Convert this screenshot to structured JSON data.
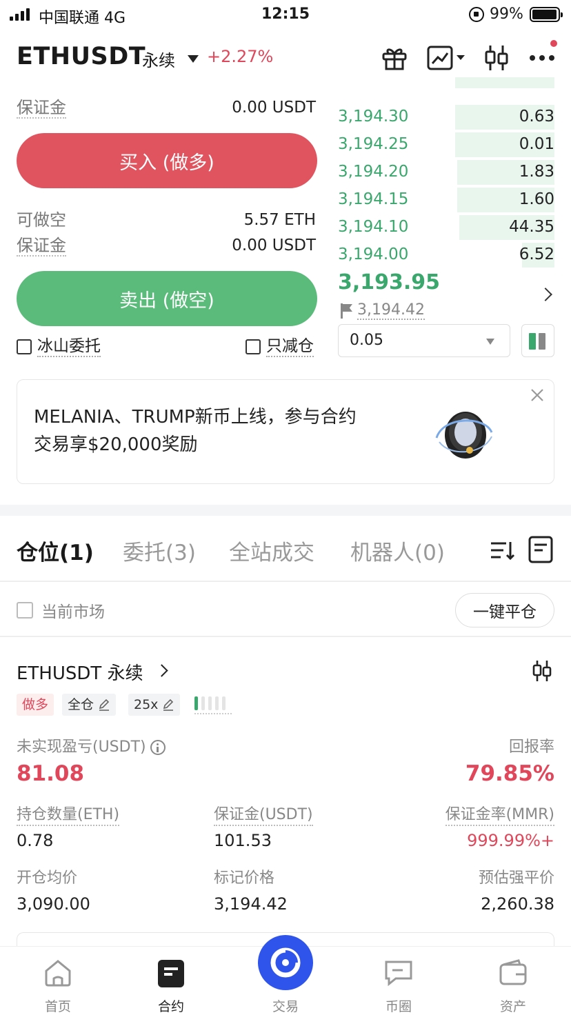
{
  "status_bar": {
    "carrier": "中国联通  4G",
    "time": "12:15",
    "battery": "99%"
  },
  "header": {
    "symbol": "ETHUSDT",
    "contract_type": "永续",
    "change": "+2.27%"
  },
  "trade_panel": {
    "buy_margin_label": "保证金",
    "buy_margin_value": "0.00 USDT",
    "buy_button": "买入 (做多)",
    "short_label": "可做空",
    "short_value": "5.57 ETH",
    "sell_margin_label": "保证金",
    "sell_margin_value": "0.00 USDT",
    "sell_button": "卖出 (做空)",
    "iceberg_label": "冰山委托",
    "reduce_only_label": "只减仓"
  },
  "order_book": {
    "rows": [
      {
        "price": "3,194.30",
        "qty": "0.63",
        "depth": 0.46
      },
      {
        "price": "3,194.25",
        "qty": "0.01",
        "depth": 0.46
      },
      {
        "price": "3,194.20",
        "qty": "1.83",
        "depth": 0.45
      },
      {
        "price": "3,194.15",
        "qty": "1.60",
        "depth": 0.45
      },
      {
        "price": "3,194.10",
        "qty": "44.35",
        "depth": 0.44
      },
      {
        "price": "3,194.00",
        "qty": "6.52",
        "depth": 0.15
      }
    ],
    "last_price": "3,193.95",
    "mark_price": "3,194.42",
    "qty_selector": "0.05"
  },
  "banner": {
    "text_line1": "MELANIA、TRUMP新币上线，参与合约",
    "text_line2": "交易享$20,000奖励"
  },
  "tabs": [
    {
      "label": "仓位(1)",
      "active": true
    },
    {
      "label": "委托(3)",
      "active": false
    },
    {
      "label": "全站成交",
      "active": false
    },
    {
      "label": "机器人(0)",
      "active": false
    }
  ],
  "filter": {
    "current_market": "当前市场",
    "close_all": "一键平仓"
  },
  "position": {
    "title": "ETHUSDT 永续",
    "side_tag": "做多",
    "margin_mode": "全仓",
    "leverage": "25x",
    "risk_level": 1,
    "risk_levels_total": 5,
    "unrealized_pnl_label": "未实现盈亏(USDT)",
    "unrealized_pnl": "81.08",
    "roe_label": "回报率",
    "roe": "79.85%",
    "size_label": "持仓数量(ETH)",
    "size": "0.78",
    "margin_label": "保证金(USDT)",
    "margin": "101.53",
    "mmr_label": "保证金率(MMR)",
    "mmr": "999.99%+",
    "entry_label": "开仓均价",
    "entry": "3,090.00",
    "mark_label": "标记价格",
    "mark": "3,194.42",
    "liq_label": "预估强平价",
    "liq": "2,260.38"
  },
  "bottom_nav": [
    {
      "label": "首页",
      "icon": "home-icon"
    },
    {
      "label": "合约",
      "icon": "contract-icon"
    },
    {
      "label": "交易",
      "icon": "trade-icon"
    },
    {
      "label": "币圈",
      "icon": "chat-icon"
    },
    {
      "label": "资产",
      "icon": "wallet-icon"
    }
  ],
  "colors": {
    "up_green": "#3aa76d",
    "down_red": "#e0475a",
    "buy_button": "#e0545f",
    "sell_button": "#5abb7a",
    "brand_blue": "#2f54eb"
  }
}
